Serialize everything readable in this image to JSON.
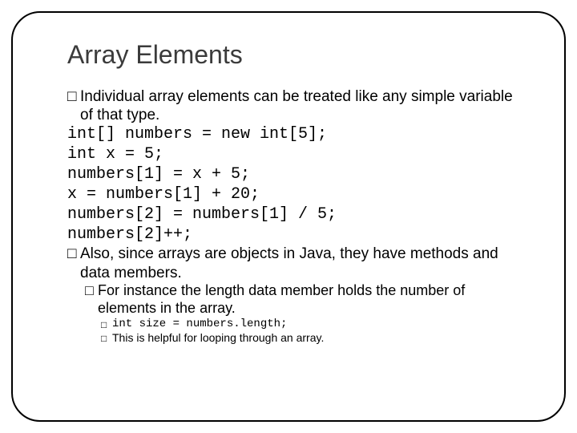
{
  "title": "Array Elements",
  "bullet1": {
    "glyph": "□",
    "text": "Individual array elements can be treated like any simple variable of that type."
  },
  "code": {
    "line1": "int[] numbers = new int[5];",
    "line2": "int x = 5;",
    "line3": "numbers[1] = x + 5;",
    "line4": "x = numbers[1] + 20;",
    "line5": "numbers[2] = numbers[1] / 5;",
    "line6": "numbers[2]++;"
  },
  "bullet2": {
    "glyph": "□",
    "text": "Also, since arrays are objects in Java, they have methods and data members."
  },
  "sub1": {
    "glyph": "□",
    "text": "For instance the length data member holds the number of elements in the array."
  },
  "sub2a": {
    "glyph": "□",
    "code": "int size = numbers.length;"
  },
  "sub2b": {
    "glyph": "□",
    "text": "This is helpful for looping through an array."
  }
}
